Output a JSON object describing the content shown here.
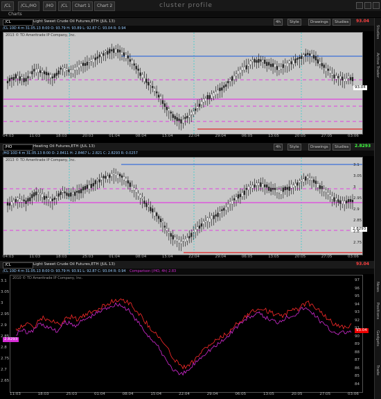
{
  "app": {
    "tabs": [
      "/CL",
      "/CL,/HO",
      "/HO",
      "/CL",
      "Chart 1",
      "Chart 2"
    ],
    "title": "cluster profile",
    "subtitle": "Charts"
  },
  "panel1": {
    "symbol": "/CL",
    "description": "Light Sweet Crude Oil Futures,ETH (JUL 13)",
    "price": "93.04",
    "info": "/CL 10D 4 m 31.05.13 8:00 O: 93.79 H: 93.89 L: 92.87 C: 93.04 R: 0.94",
    "copyright": "2013 © TD Ameritrade IP Company, Inc.",
    "right_price": "93.04",
    "buttons": {
      "style": "Style",
      "drawings": "Drawings",
      "studies": "Studies",
      "interval": "4h"
    },
    "x_ticks": [
      "04:03",
      "11:03",
      "18:03",
      "20:03",
      "01:04",
      "08:04",
      "15:04",
      "22:04",
      "29:04",
      "06:05",
      "13:05",
      "20:05",
      "27:05",
      "03:06"
    ]
  },
  "panel2": {
    "symbol": "/HO",
    "description": "Heating Oil Futures,ETH (JUL 13)",
    "price": "2.8293",
    "info": "/HO 10D 4 m 31.05.13 8:00 O: 2.8411 H: 2.8467 L: 2.821 C: 2.8293 R: 0.0257",
    "copyright": "2013 © TD Ameritrade IP Company, Inc.",
    "right_price": "2.8293",
    "buttons": {
      "style": "Style",
      "drawings": "Drawings",
      "studies": "Studies",
      "interval": "4h"
    },
    "y_ticks": [
      "3.1",
      "3.05",
      "3",
      "2.95",
      "2.9",
      "2.85",
      "2.8",
      "2.75"
    ],
    "x_ticks": [
      "04:03",
      "11:03",
      "18:03",
      "25:03",
      "01:04",
      "08:04",
      "15:04",
      "22:04",
      "29:04",
      "06:05",
      "13:05",
      "20:05",
      "27:05",
      "03:06"
    ]
  },
  "panel3": {
    "symbol": "/CL",
    "description": "Light Sweet Crude Oil Futures,ETH (JUL 13)",
    "price": "93.04",
    "info": "/CL 10D 4 m 31.05.13 8:00 O: 93.79 H: 93.91 L: 92.87 C: 93.04 R: 0.94",
    "comparison": "Comparison (/HO, 4h) 2.83",
    "copyright": "2010 © TD Ameritrade IP Company, Inc.",
    "left_ticks": [
      "3.1",
      "3.05",
      "3",
      "2.95",
      "2.9",
      "2.85",
      "2.8",
      "2.75",
      "2.7",
      "2.65"
    ],
    "right_ticks": [
      "97",
      "96",
      "95",
      "94",
      "93",
      "92",
      "91",
      "90",
      "89",
      "88",
      "87",
      "86",
      "85",
      "84"
    ],
    "left_tag": "2.8293",
    "right_tag": "93.04",
    "x_ticks": [
      "11:03",
      "18:03",
      "25:03",
      "01:04",
      "08:04",
      "15:04",
      "22:04",
      "29:04",
      "06:05",
      "13:05",
      "20:05",
      "27:05",
      "03:06"
    ],
    "colors": {
      "crude": "#ff2a2a",
      "heating": "#d62bd6"
    }
  },
  "sidebar": {
    "items": [
      "Studies",
      "Active Trader",
      "News",
      "Positions",
      "Gadgets",
      "Trade"
    ]
  }
}
